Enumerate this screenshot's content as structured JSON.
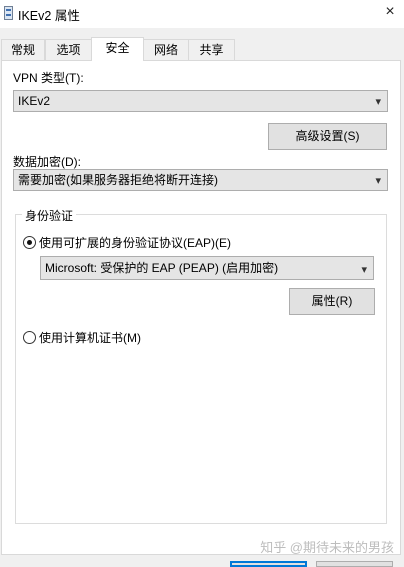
{
  "window": {
    "title": "IKEv2 属性",
    "close_glyph": "×"
  },
  "tabs": [
    {
      "label": "常规"
    },
    {
      "label": "选项"
    },
    {
      "label": "安全"
    },
    {
      "label": "网络"
    },
    {
      "label": "共享"
    }
  ],
  "security": {
    "vpn_type_label": "VPN 类型(T):",
    "vpn_type_value": "IKEv2",
    "advanced_button": "高级设置(S)",
    "encryption_label": "数据加密(D):",
    "encryption_value": "需要加密(如果服务器拒绝将断开连接)",
    "auth_group_title": "身份验证",
    "eap_option_label": "使用可扩展的身份验证协议(EAP)(E)",
    "eap_method_value": "Microsoft: 受保护的 EAP (PEAP) (启用加密)",
    "properties_button": "属性(R)",
    "cert_option_label": "使用计算机证书(M)",
    "selected_auth": "eap"
  },
  "watermark": "知乎 @期待未来的男孩",
  "icons": {
    "dropdown": "▾"
  }
}
